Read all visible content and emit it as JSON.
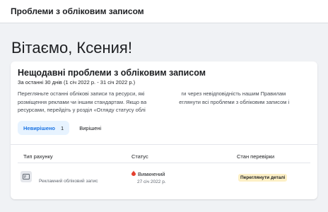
{
  "header": {
    "title": "Проблеми з обліковим записом"
  },
  "greeting": "Вітаємо, Ксения!",
  "card": {
    "title": "Нещодавні проблеми з обліковим записом",
    "date_range": "За останні 30 днів (1 січ 2022 р. - 31 січ 2022 р.)",
    "description": {
      "line1_a": "Перегляньте останні облікові записи та ресурси, які",
      "line1_b": "ги через невідповідність нашим Правилам",
      "line2_a": "розміщення реклами чи іншим стандартам. Якщо ва",
      "line2_b": "еглянути всі проблеми з обліковим записом і",
      "line3": "ресурсами, перейдіть у розділ «Огляду статусу облі"
    },
    "tabs": [
      {
        "label": "Невирішено",
        "count": "1"
      },
      {
        "label": "Вирішені"
      }
    ],
    "table": {
      "headers": [
        "Тип рахунку",
        "Статус",
        "Стан перевірки"
      ],
      "rows": [
        {
          "account_type": "Рекламний обліковий запис",
          "status": "Вимкнений",
          "status_date": "27 січ 2022 р.",
          "review_action": "Переглянути деталі"
        }
      ]
    }
  },
  "colors": {
    "accent": "#1b74e4",
    "status_red": "#e4402f",
    "review_bg": "#fdf0c6",
    "page_bg": "#f0f2f5"
  },
  "icons": {
    "account": "ad-account-icon",
    "status": "disabled-status-icon"
  }
}
